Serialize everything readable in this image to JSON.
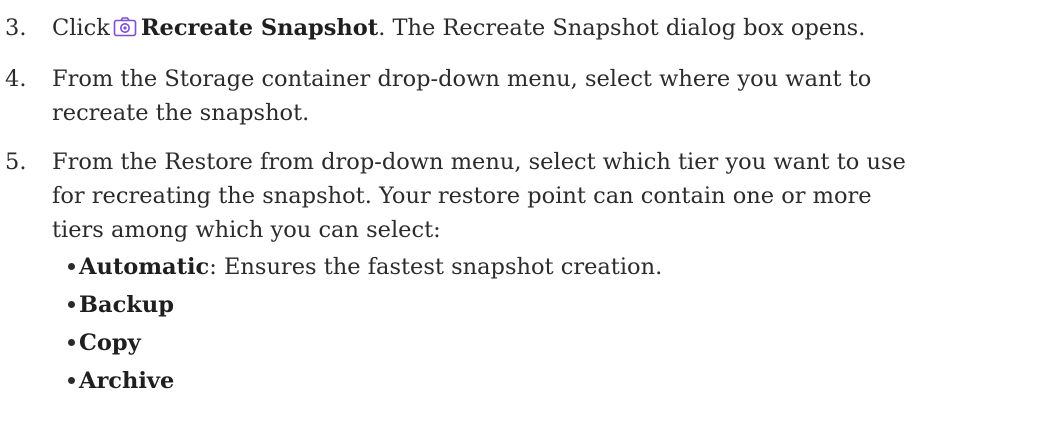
{
  "steps": [
    {
      "number": "3.",
      "pre": "Click",
      "icon": "camera-icon",
      "bold": "Recreate Snapshot",
      "post": ". The Recreate Snapshot dialog box opens."
    },
    {
      "number": "4.",
      "lines": [
        "From the Storage container drop-down menu, select where you want to",
        "recreate the snapshot."
      ]
    },
    {
      "number": "5.",
      "lines": [
        "From the Restore from drop-down menu, select which tier you want to use",
        "for recreating the snapshot. Your restore point can contain one or more",
        "tiers among which you can select:"
      ]
    }
  ],
  "bullets": [
    {
      "bold": "Automatic",
      "text": ": Ensures the fastest snapshot creation."
    },
    {
      "bold": "Backup",
      "text": ""
    },
    {
      "bold": "Copy",
      "text": ""
    },
    {
      "bold": "Archive",
      "text": ""
    }
  ],
  "colors": {
    "text": "#2b2b2b",
    "icon_accent": "#7b4fd6"
  }
}
